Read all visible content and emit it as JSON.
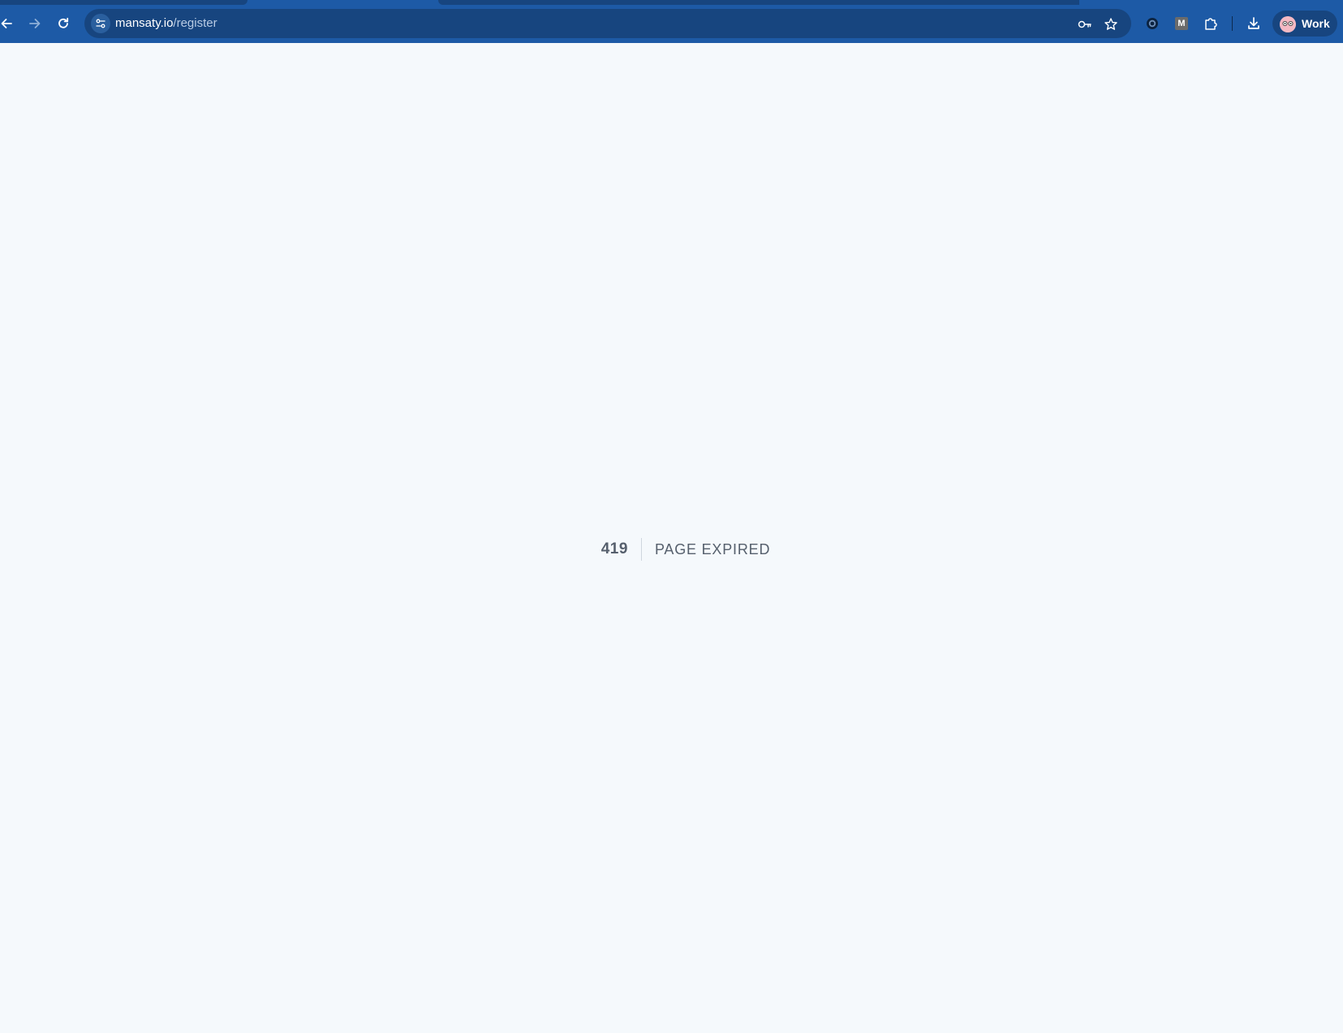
{
  "browser": {
    "url_host": "mansaty.io",
    "url_path": "/register",
    "profile_label": "Work",
    "extension_m_label": "M"
  },
  "error": {
    "code": "419",
    "message": "PAGE EXPIRED"
  },
  "colors": {
    "chrome_bg": "#1d5aa6",
    "omnibox_bg": "#17457f",
    "page_bg": "#f5f9fc",
    "text": "#56606d"
  }
}
